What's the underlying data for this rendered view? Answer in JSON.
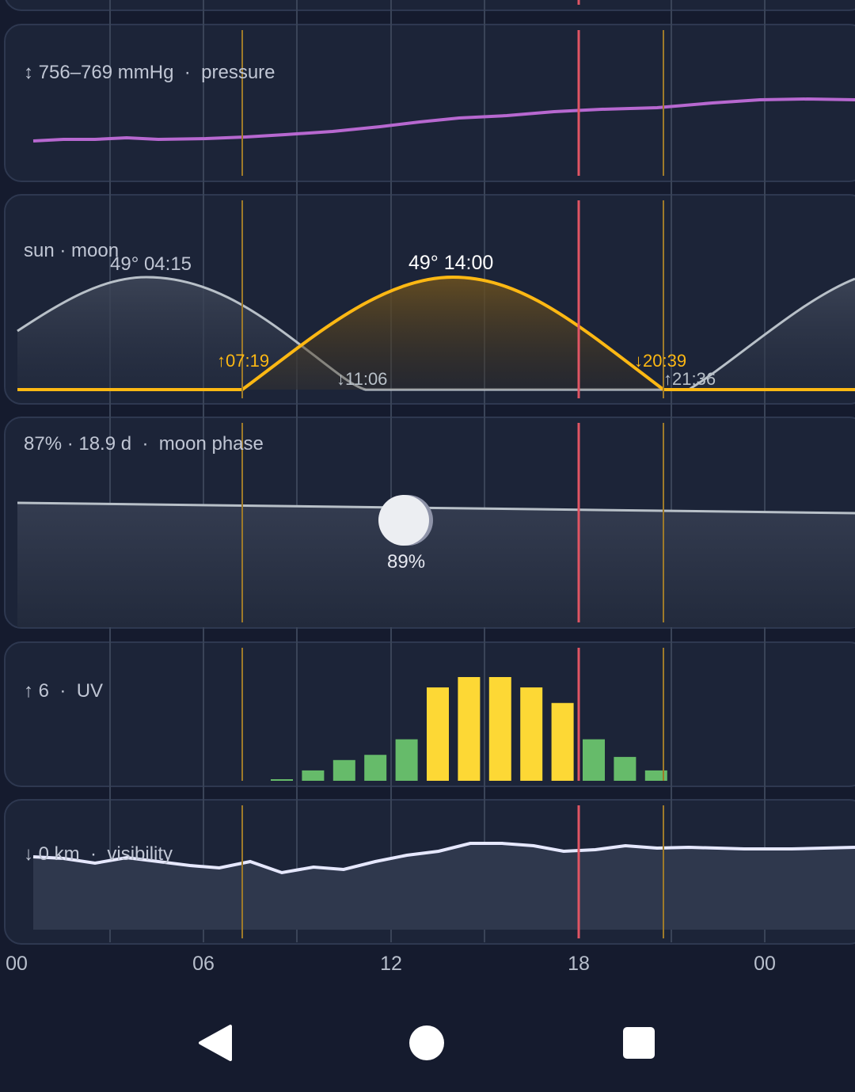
{
  "panels": {
    "pressure": {
      "range": "↕ 756–769 mmHg",
      "sep": "·",
      "name": "pressure",
      "color": "#b768d0"
    },
    "sunmoon": {
      "title": "sun · moon",
      "moon_peak": "49° 04:15",
      "sun_peak": "49° 14:00",
      "sunrise": "↑07:19",
      "moonset": "↓11:06",
      "sunset": "↓20:39",
      "moonrise": "↑21:36",
      "sun_color": "#fdb813",
      "moon_color": "#b8c0c8"
    },
    "moonphase": {
      "summary": "87% · 18.9 d",
      "sep": "·",
      "name": "moon phase",
      "current": "89%"
    },
    "uv": {
      "summary": "↑ 6",
      "sep": "·",
      "name": "UV",
      "values": [
        0.1,
        1,
        2,
        2.5,
        4,
        9,
        10,
        10,
        9,
        7.5,
        4,
        2.3,
        1
      ],
      "low_color": "#66bb6a",
      "high_color": "#fdd835"
    },
    "visibility": {
      "summary": "↓ 0 km",
      "sep": "·",
      "name": "visibility"
    }
  },
  "time_axis": {
    "ticks": [
      "00",
      "06",
      "12",
      "18",
      "00"
    ],
    "now_marker": "18",
    "now_color": "#e05563"
  },
  "navbar": {
    "back": "back-icon",
    "home": "home-icon",
    "recents": "recents-icon"
  }
}
